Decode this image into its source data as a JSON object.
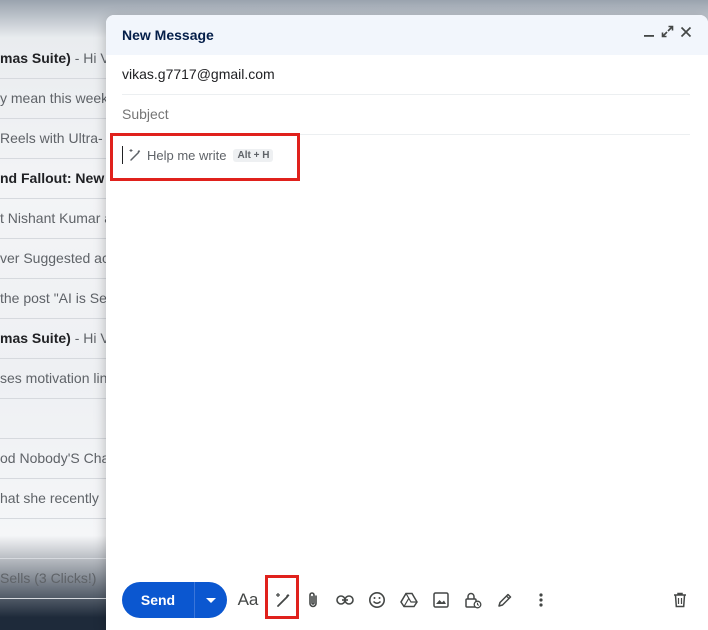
{
  "background_inbox": {
    "rows": [
      {
        "bold": "mas Suite)",
        "light": " - Hi Vi",
        "is_bold": true
      },
      {
        "bold": "",
        "light": "y mean this week",
        "is_bold": false
      },
      {
        "bold": "",
        "light": " Reels with Ultra-",
        "is_bold": false
      },
      {
        "bold": "nd Fallout: New V",
        "light": "",
        "is_bold": true
      },
      {
        "bold": "",
        "light": "t Nishant Kumar a",
        "is_bold": false
      },
      {
        "bold": "",
        "light": "ver Suggested ac",
        "is_bold": false
      },
      {
        "bold": "",
        "light": "the post \"AI is Se",
        "is_bold": false
      },
      {
        "bold": "mas Suite)",
        "light": " - Hi Vi",
        "is_bold": true
      },
      {
        "bold": "",
        "light": "ses motivation lin",
        "is_bold": false
      },
      {
        "bold": "",
        "light": "",
        "is_bold": false
      },
      {
        "bold": "",
        "light": "od Nobody'S Cha",
        "is_bold": false
      },
      {
        "bold": "",
        "light": "hat she recently",
        "is_bold": false
      },
      {
        "bold": "",
        "light": "",
        "is_bold": false
      },
      {
        "bold": "",
        "light": " Sells (3 Clicks!)",
        "is_bold": false
      }
    ]
  },
  "compose": {
    "title": "New Message",
    "header_icons": [
      "minimize-icon",
      "expand-icon",
      "close-icon"
    ],
    "to": "vikas.g7717@gmail.com",
    "subject_placeholder": "Subject",
    "help_me_write": {
      "label": "Help me write",
      "shortcut": "Alt + H",
      "icon": "pen-sparkle-icon"
    },
    "send_label": "Send",
    "toolbar_icons": [
      "formatting-icon",
      "help-me-write-icon",
      "attach-icon",
      "link-icon",
      "emoji-icon",
      "drive-icon",
      "photo-icon",
      "confidential-mode-icon",
      "signature-icon",
      "more-options-icon",
      "delete-icon"
    ],
    "formatting_label": "Aa"
  },
  "colors": {
    "accent": "#0b57d0",
    "highlight": "#e0211c",
    "header_bg": "#f2f6fc"
  }
}
